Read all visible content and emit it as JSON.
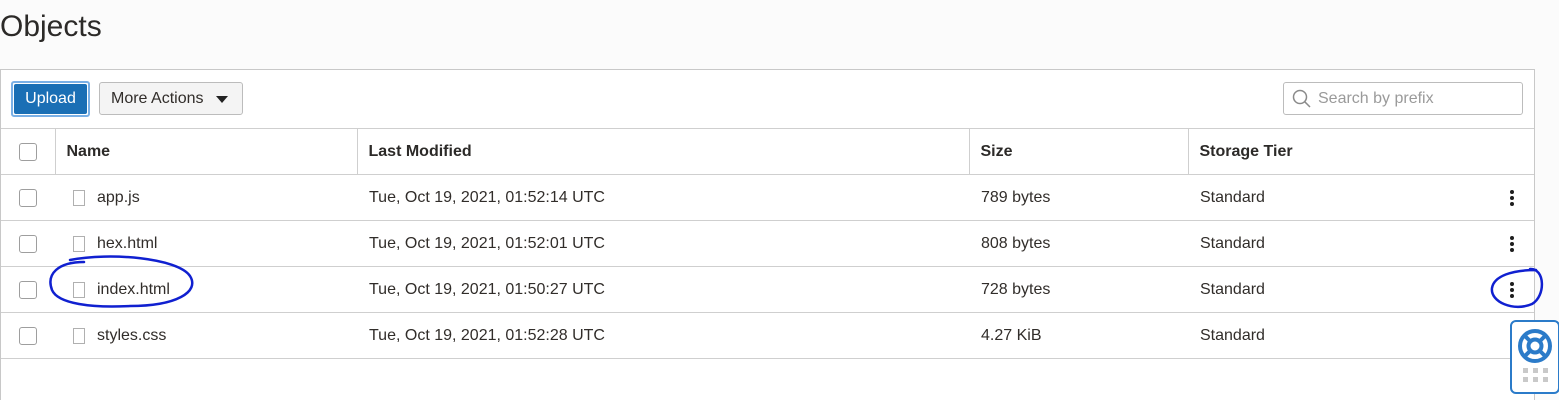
{
  "page": {
    "title": "Objects"
  },
  "toolbar": {
    "upload_label": "Upload",
    "more_actions_label": "More Actions",
    "search_placeholder": "Search by prefix"
  },
  "table": {
    "columns": [
      "Name",
      "Last Modified",
      "Size",
      "Storage Tier"
    ],
    "rows": [
      {
        "name": "app.js",
        "modified": "Tue, Oct 19, 2021, 01:52:14 UTC",
        "size": "789 bytes",
        "tier": "Standard"
      },
      {
        "name": "hex.html",
        "modified": "Tue, Oct 19, 2021, 01:52:01 UTC",
        "size": "808 bytes",
        "tier": "Standard"
      },
      {
        "name": "index.html",
        "modified": "Tue, Oct 19, 2021, 01:50:27 UTC",
        "size": "728 bytes",
        "tier": "Standard"
      },
      {
        "name": "styles.css",
        "modified": "Tue, Oct 19, 2021, 01:52:28 UTC",
        "size": "4.27 KiB",
        "tier": "Standard"
      }
    ]
  },
  "icons": {
    "search": "search-icon",
    "caret": "caret-down-icon",
    "file": "file-icon",
    "row_actions": "kebab-menu-icon",
    "help": "lifebuoy-icon",
    "grip": "drag-grip-icon"
  },
  "colors": {
    "primary_button": "#1a6fb5",
    "annotation": "#1020d0",
    "help_accent": "#2b7bc9"
  }
}
